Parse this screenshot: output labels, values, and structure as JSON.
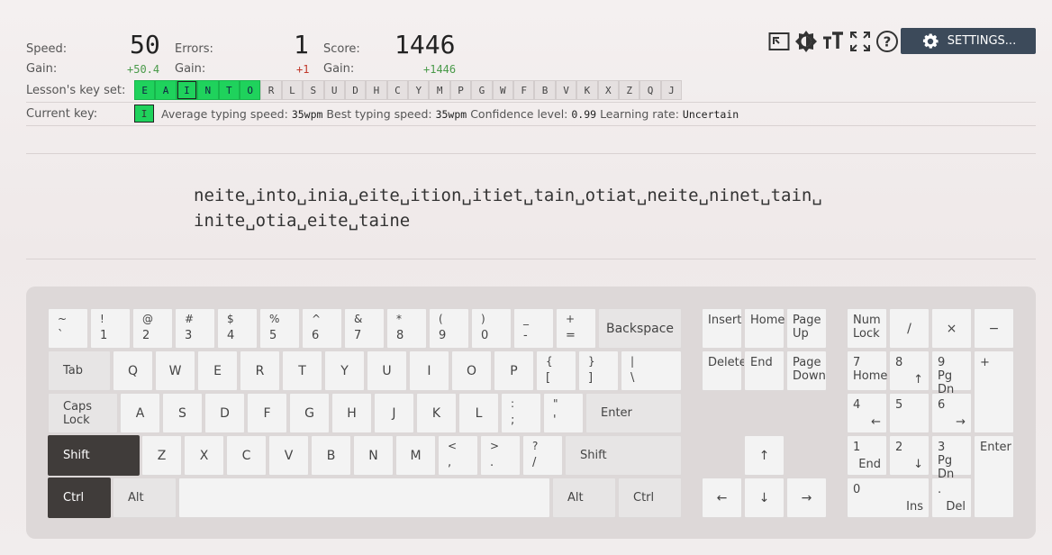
{
  "stats": {
    "speed_label": "Speed:",
    "speed": "50",
    "speed_gain_label": "Gain:",
    "speed_gain": "+50.4",
    "errors_label": "Errors:",
    "errors": "1",
    "errors_gain_label": "Gain:",
    "errors_gain": "+1",
    "score_label": "Score:",
    "score": "1446",
    "score_gain_label": "Gain:",
    "score_gain": "+1446"
  },
  "toolbar": {
    "settings_label": "SETTINGS...",
    "icons": [
      "keyboard-layout-icon",
      "theme-icon",
      "text-size-icon",
      "fullscreen-icon",
      "help-icon",
      "gear-icon"
    ]
  },
  "keyset": {
    "label": "Lesson's key set:",
    "keys": [
      {
        "k": "E",
        "inc": true
      },
      {
        "k": "A",
        "inc": true
      },
      {
        "k": "I",
        "inc": true
      },
      {
        "k": "N",
        "inc": true
      },
      {
        "k": "T",
        "inc": true
      },
      {
        "k": "O",
        "inc": true
      },
      {
        "k": "R",
        "inc": false
      },
      {
        "k": "L",
        "inc": false
      },
      {
        "k": "S",
        "inc": false
      },
      {
        "k": "U",
        "inc": false
      },
      {
        "k": "D",
        "inc": false
      },
      {
        "k": "H",
        "inc": false
      },
      {
        "k": "C",
        "inc": false
      },
      {
        "k": "Y",
        "inc": false
      },
      {
        "k": "M",
        "inc": false
      },
      {
        "k": "P",
        "inc": false
      },
      {
        "k": "G",
        "inc": false
      },
      {
        "k": "W",
        "inc": false
      },
      {
        "k": "F",
        "inc": false
      },
      {
        "k": "B",
        "inc": false
      },
      {
        "k": "V",
        "inc": false
      },
      {
        "k": "K",
        "inc": false
      },
      {
        "k": "X",
        "inc": false
      },
      {
        "k": "Z",
        "inc": false
      },
      {
        "k": "Q",
        "inc": false
      },
      {
        "k": "J",
        "inc": false
      }
    ],
    "current_index": 2
  },
  "current": {
    "label": "Current key:",
    "key": "I",
    "avg_label": "Average typing speed:",
    "avg": "35wpm",
    "best_label": "Best typing speed:",
    "best": "35wpm",
    "conf_label": "Confidence level:",
    "conf": "0.99",
    "rate_label": "Learning rate:",
    "rate": "Uncertain"
  },
  "lesson": {
    "line1": "neite␣into␣inia␣eite␣ition␣itiet␣tain␣otiat␣neite␣ninet␣tain␣",
    "line2": "inite␣otia␣eite␣taine"
  },
  "keyboard": {
    "row1": [
      "~|`",
      "!|1",
      "@|2",
      "#|3",
      "$|4",
      "%|5",
      "^|6",
      "&|7",
      "*|8",
      "(|9",
      ")|0",
      "_|-",
      "+|="
    ],
    "backspace": "Backspace",
    "tab": "Tab",
    "row2": [
      "Q",
      "W",
      "E",
      "R",
      "T",
      "Y",
      "U",
      "I",
      "O",
      "P"
    ],
    "row2_sym": [
      "{|[",
      "}|]",
      "||\\"
    ],
    "caps": "Caps Lock",
    "row3": [
      "A",
      "S",
      "D",
      "F",
      "G",
      "H",
      "J",
      "K",
      "L"
    ],
    "row3_sym": [
      ":|;",
      "\"|'"
    ],
    "enter": "Enter",
    "shift": "Shift",
    "row4": [
      "Z",
      "X",
      "C",
      "V",
      "B",
      "N",
      "M"
    ],
    "row4_sym": [
      "<|,",
      ">|.",
      "?|/"
    ],
    "ctrl": "Ctrl",
    "alt": "Alt",
    "nav": {
      "insert": "Insert",
      "home": "Home",
      "pageup": "Page Up",
      "delete": "Delete",
      "end": "End",
      "pagedown": "Page Down",
      "up": "↑",
      "left": "←",
      "down": "↓",
      "right": "→"
    },
    "numpad": {
      "numlock": "Num Lock",
      "div": "/",
      "mul": "×",
      "minus": "−",
      "plus": "+",
      "enter": "Enter",
      "n7": "7",
      "n7b": "Home",
      "n8": "8",
      "n8b": "↑",
      "n9": "9",
      "n9b": "Pg Dn",
      "n4": "4",
      "n4b": "←",
      "n5": "5",
      "n6": "6",
      "n6b": "→",
      "n1": "1",
      "n1b": "End",
      "n2": "2",
      "n2b": "↓",
      "n3": "3",
      "n3b": "Pg Dn",
      "n0": "0",
      "n0b": "Ins",
      "dot": ".",
      "dotb": "Del"
    }
  }
}
